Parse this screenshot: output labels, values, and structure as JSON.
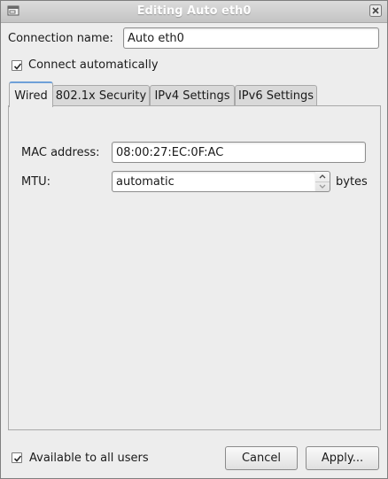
{
  "window": {
    "title": "Editing Auto eth0"
  },
  "connection": {
    "name_label": "Connection name:",
    "name_value": "Auto eth0",
    "auto_connect_label": "Connect automatically",
    "auto_connect_checked": true
  },
  "tabs": [
    {
      "label": "Wired",
      "active": true
    },
    {
      "label": "802.1x Security",
      "active": false
    },
    {
      "label": "IPv4 Settings",
      "active": false
    },
    {
      "label": "IPv6 Settings",
      "active": false
    }
  ],
  "wired": {
    "mac_label": "MAC address:",
    "mac_value": "08:00:27:EC:0F:AC",
    "mtu_label": "MTU:",
    "mtu_value": "automatic",
    "mtu_unit": "bytes"
  },
  "footer": {
    "all_users_label": "Available to all users",
    "all_users_checked": true,
    "cancel_label": "Cancel",
    "apply_label": "Apply..."
  },
  "icons": {
    "window_menu": "window-menu-icon",
    "close": "close-icon",
    "check": "check-icon",
    "spin_up": "chevron-up-icon",
    "spin_down": "chevron-down-icon"
  }
}
